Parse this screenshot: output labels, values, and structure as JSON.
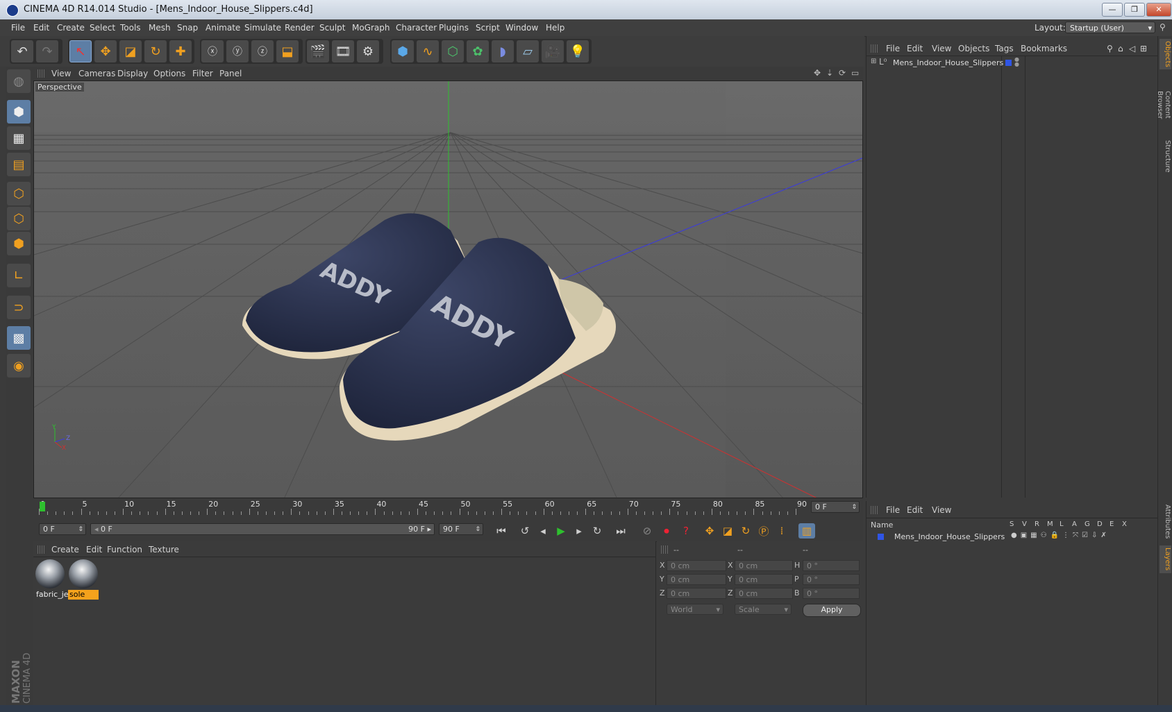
{
  "window": {
    "title": "CINEMA 4D R14.014 Studio - [Mens_Indoor_House_Slippers.c4d]",
    "minimize": "—",
    "maximize": "❐",
    "close": "✕"
  },
  "menubar": {
    "items": [
      "File",
      "Edit",
      "Create",
      "Select",
      "Tools",
      "Mesh",
      "Snap",
      "Animate",
      "Simulate",
      "Render",
      "Sculpt",
      "MoGraph",
      "Character",
      "Plugins",
      "Script",
      "Window",
      "Help"
    ],
    "layout_label": "Layout:",
    "layout_value": "Startup (User)"
  },
  "toolbar": {
    "icons": [
      "undo-icon",
      "redo-icon",
      "live-selection-icon",
      "move-icon",
      "scale-icon",
      "rotate-icon",
      "add-icon",
      "x-axis-icon",
      "y-axis-icon",
      "z-axis-icon",
      "coordinate-system-icon",
      "render-view-icon",
      "render-picture-viewer-icon",
      "render-settings-icon",
      "cube-icon",
      "spline-icon",
      "subdivision-icon",
      "mograph-icon",
      "deformer-icon",
      "floor-icon",
      "camera-icon",
      "light-icon"
    ]
  },
  "viewport": {
    "menu": [
      "View",
      "Cameras",
      "Display",
      "Options",
      "Filter",
      "Panel"
    ],
    "label": "Perspective",
    "axis_y": "Y",
    "axis_z": "Z",
    "axis_x": "X"
  },
  "timeline": {
    "ticks": [
      "0",
      "5",
      "10",
      "15",
      "20",
      "25",
      "30",
      "35",
      "40",
      "45",
      "50",
      "55",
      "60",
      "65",
      "70",
      "75",
      "80",
      "85",
      "90"
    ],
    "end_field": "0 F",
    "current_frame": "0 F",
    "range_start": "0 F",
    "range_end": "90 F",
    "max_frame": "90 F"
  },
  "materials": {
    "menu": [
      "Create",
      "Edit",
      "Function",
      "Texture"
    ],
    "items": [
      {
        "name": "fabric_je",
        "selected": false
      },
      {
        "name": "sole",
        "selected": true
      }
    ]
  },
  "coordinates": {
    "headers": [
      "--",
      "--",
      "--"
    ],
    "rows": [
      {
        "l1": "X",
        "v1": "0 cm",
        "l2": "X",
        "v2": "0 cm",
        "l3": "H",
        "v3": "0 °"
      },
      {
        "l1": "Y",
        "v1": "0 cm",
        "l2": "Y",
        "v2": "0 cm",
        "l3": "P",
        "v3": "0 °"
      },
      {
        "l1": "Z",
        "v1": "0 cm",
        "l2": "Z",
        "v2": "0 cm",
        "l3": "B",
        "v3": "0 °"
      }
    ],
    "space": "World",
    "mode": "Scale",
    "apply": "Apply"
  },
  "objects": {
    "menu": [
      "File",
      "Edit",
      "View",
      "Objects",
      "Tags",
      "Bookmarks"
    ],
    "items": [
      "Mens_Indoor_House_Slippers"
    ]
  },
  "layers": {
    "menu": [
      "File",
      "Edit",
      "View"
    ],
    "header_name": "Name",
    "columns": [
      "S",
      "V",
      "R",
      "M",
      "L",
      "A",
      "G",
      "D",
      "E",
      "X"
    ],
    "items": [
      "Mens_Indoor_House_Slippers"
    ]
  },
  "side_tabs": [
    "Objects",
    "Content Browser",
    "Structure",
    "Attributes",
    "Layers"
  ],
  "brand": {
    "maxon": "MAXON",
    "product": "CINEMA 4D"
  },
  "colors": {
    "accent": "#f4a21c",
    "selected_tool": "#5d7ea5",
    "layer_color": "#2f55e6"
  }
}
